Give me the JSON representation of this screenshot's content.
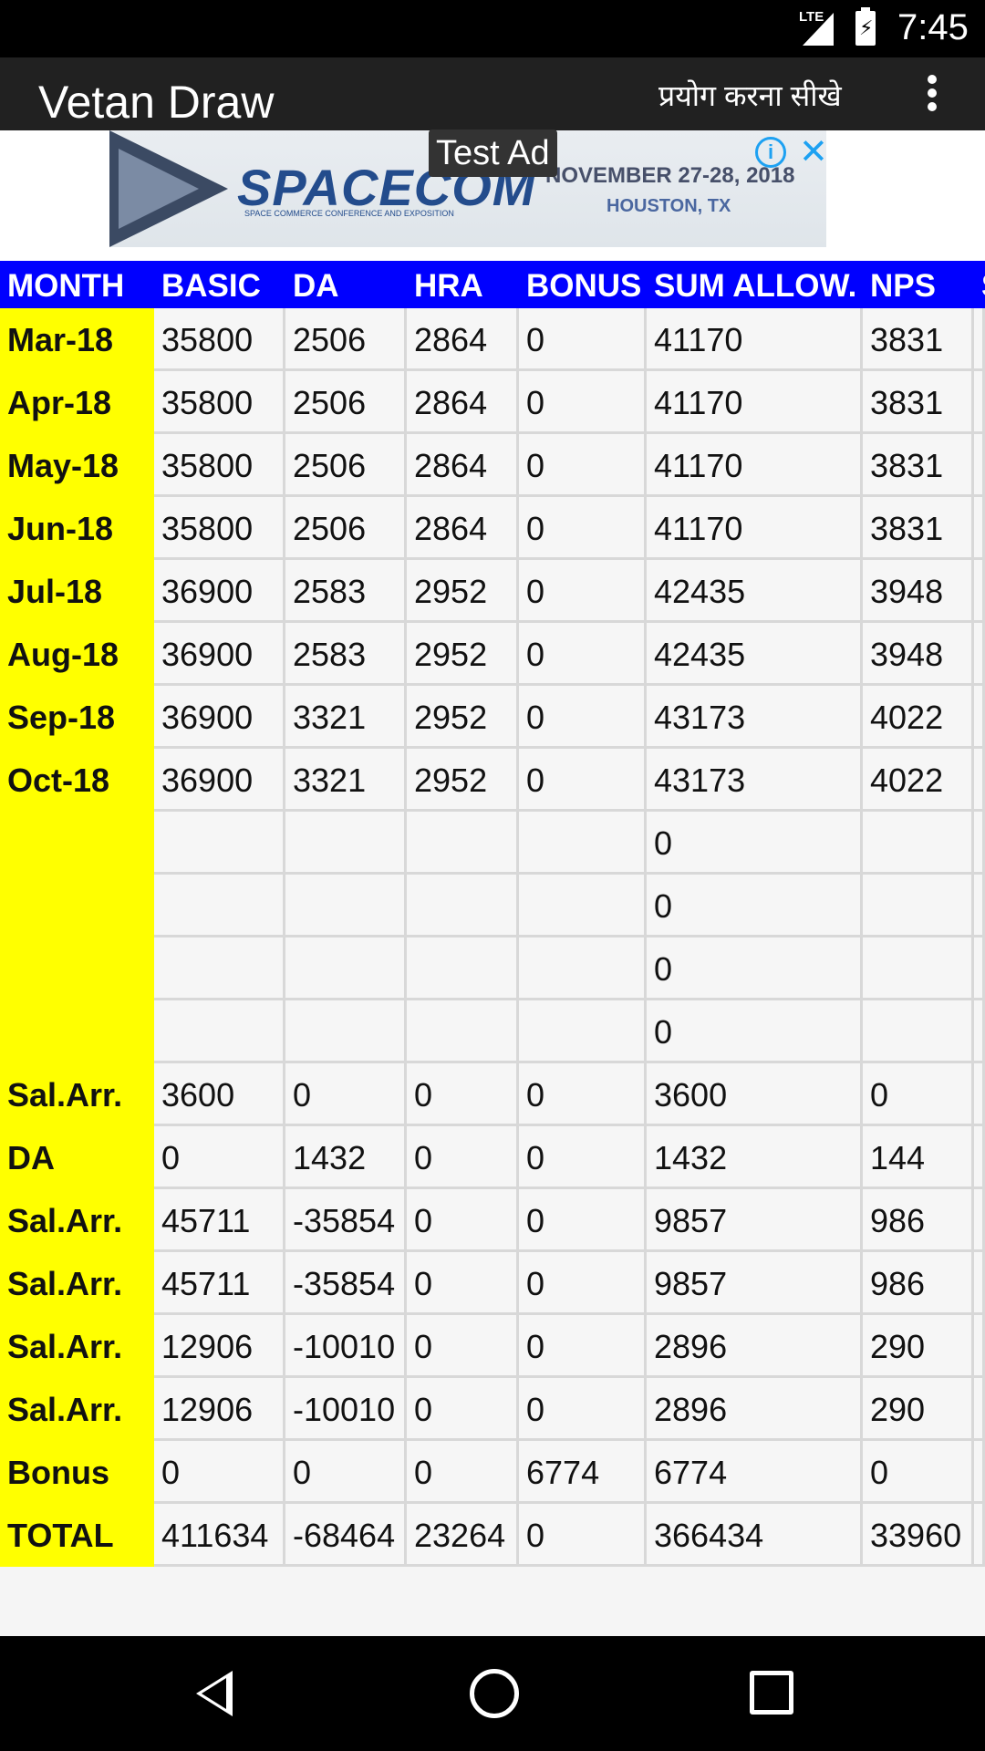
{
  "status_bar": {
    "network": "LTE",
    "time": "7:45"
  },
  "app_bar": {
    "title": "Vetan Draw",
    "learn_label": "प्रयोग करना सीखे",
    "menu_icon": "more-vert-icon"
  },
  "ad": {
    "label": "Test Ad",
    "brand": "SPACECOM",
    "brand_sub": "SPACE COMMERCE CONFERENCE AND EXPOSITION",
    "date": "NOVEMBER 27-28, 2018",
    "city": "HOUSTON, TX",
    "info_icon": "info-icon",
    "close_icon": "close-icon"
  },
  "table": {
    "headers": [
      "MONTH",
      "BASIC",
      "DA",
      "HRA",
      "BONUS",
      "SUM ALLOW.",
      "NPS",
      "S"
    ],
    "rows": [
      [
        "Mar-18",
        "35800",
        "2506",
        "2864",
        "0",
        "41170",
        "3831"
      ],
      [
        "Apr-18",
        "35800",
        "2506",
        "2864",
        "0",
        "41170",
        "3831"
      ],
      [
        "May-18",
        "35800",
        "2506",
        "2864",
        "0",
        "41170",
        "3831"
      ],
      [
        "Jun-18",
        "35800",
        "2506",
        "2864",
        "0",
        "41170",
        "3831"
      ],
      [
        "Jul-18",
        "36900",
        "2583",
        "2952",
        "0",
        "42435",
        "3948"
      ],
      [
        "Aug-18",
        "36900",
        "2583",
        "2952",
        "0",
        "42435",
        "3948"
      ],
      [
        "Sep-18",
        "36900",
        "3321",
        "2952",
        "0",
        "43173",
        "4022"
      ],
      [
        "Oct-18",
        "36900",
        "3321",
        "2952",
        "0",
        "43173",
        "4022"
      ],
      [
        "",
        "",
        "",
        "",
        "",
        "0",
        ""
      ],
      [
        "",
        "",
        "",
        "",
        "",
        "0",
        ""
      ],
      [
        "",
        "",
        "",
        "",
        "",
        "0",
        ""
      ],
      [
        "",
        "",
        "",
        "",
        "",
        "0",
        ""
      ],
      [
        "Sal.Arr.",
        "3600",
        "0",
        "0",
        "0",
        "3600",
        "0"
      ],
      [
        " DA",
        "0",
        "1432",
        "0",
        "0",
        "1432",
        "144"
      ],
      [
        "Sal.Arr.",
        "45711",
        "-35854",
        "0",
        "0",
        "9857",
        "986"
      ],
      [
        "Sal.Arr.",
        "45711",
        "-35854",
        "0",
        "0",
        "9857",
        "986"
      ],
      [
        "Sal.Arr.",
        "12906",
        "-10010",
        "0",
        "0",
        "2896",
        "290"
      ],
      [
        "Sal.Arr.",
        "12906",
        "-10010",
        "0",
        "0",
        "2896",
        "290"
      ],
      [
        " Bonus",
        "0",
        "0",
        "0",
        "6774",
        "6774",
        "0"
      ],
      [
        "TOTAL",
        "411634",
        "-68464",
        "23264",
        "0",
        "366434",
        "33960"
      ]
    ]
  },
  "nav_bar": {
    "back_icon": "back-icon",
    "home_icon": "home-icon",
    "recents_icon": "recents-icon"
  }
}
